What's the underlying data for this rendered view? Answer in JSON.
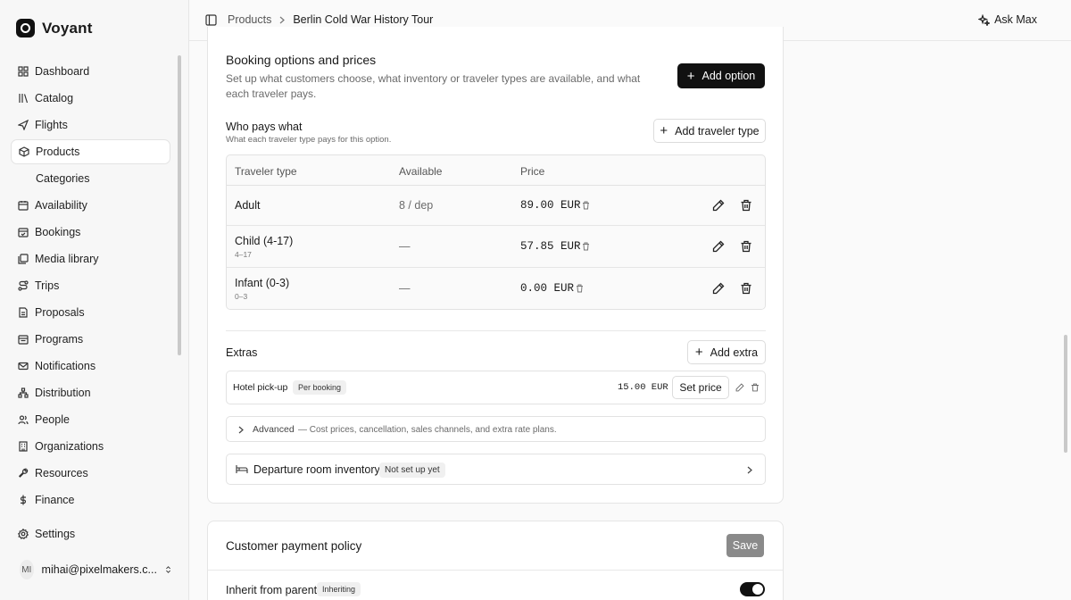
{
  "app": {
    "name": "Voyant"
  },
  "sidebar": {
    "items": [
      {
        "label": "Dashboard",
        "icon": "grid-icon"
      },
      {
        "label": "Catalog",
        "icon": "library-icon"
      },
      {
        "label": "Flights",
        "icon": "plane-icon"
      },
      {
        "label": "Products",
        "icon": "package-icon",
        "active": true
      },
      {
        "label": "Categories",
        "icon": "",
        "sub": true
      },
      {
        "label": "Availability",
        "icon": "calendar-icon"
      },
      {
        "label": "Bookings",
        "icon": "calendar-check-icon"
      },
      {
        "label": "Media library",
        "icon": "images-icon"
      },
      {
        "label": "Trips",
        "icon": "route-icon"
      },
      {
        "label": "Proposals",
        "icon": "file-icon"
      },
      {
        "label": "Programs",
        "icon": "calendar-range-icon"
      },
      {
        "label": "Notifications",
        "icon": "mail-icon"
      },
      {
        "label": "Distribution",
        "icon": "network-icon"
      },
      {
        "label": "People",
        "icon": "users-icon"
      },
      {
        "label": "Organizations",
        "icon": "building-icon"
      },
      {
        "label": "Resources",
        "icon": "wrench-icon"
      },
      {
        "label": "Finance",
        "icon": "dollar-icon"
      }
    ],
    "settings": "Settings",
    "user": {
      "initials": "MI",
      "email": "mihai@pixelmakers.c..."
    }
  },
  "topbar": {
    "breadcrumb": [
      "Products",
      "Berlin Cold War History Tour"
    ],
    "ask": "Ask Max"
  },
  "booking": {
    "title": "Booking options and prices",
    "description": "Set up what customers choose, what inventory or traveler types are available, and what each traveler pays.",
    "add_option": "Add option",
    "who_pays": {
      "title": "Who pays what",
      "subtitle": "What each traveler type pays for this option.",
      "add_button": "Add traveler type",
      "columns": [
        "Traveler type",
        "Available",
        "Price"
      ],
      "rows": [
        {
          "type": "Adult",
          "range": "",
          "available": "8 / dep",
          "price": "89.00 EUR"
        },
        {
          "type": "Child (4-17)",
          "range": "4–17",
          "available": "—",
          "price": "57.85 EUR"
        },
        {
          "type": "Infant (0-3)",
          "range": "0–3",
          "available": "—",
          "price": "0.00 EUR"
        }
      ]
    },
    "extras": {
      "title": "Extras",
      "add_button": "Add extra",
      "items": [
        {
          "name": "Hotel pick-up",
          "badge": "Per booking",
          "price": "15.00 EUR",
          "action": "Set price"
        }
      ]
    },
    "advanced": {
      "label": "Advanced",
      "description": "— Cost prices, cancellation, sales channels, and extra rate plans."
    },
    "room_inventory": {
      "label": "Departure room inventory",
      "badge": "Not set up yet"
    }
  },
  "payment_policy": {
    "title": "Customer payment policy",
    "save": "Save",
    "inherit_label": "Inherit from parent",
    "inherit_badge": "Inheriting",
    "inherit_on": true
  }
}
